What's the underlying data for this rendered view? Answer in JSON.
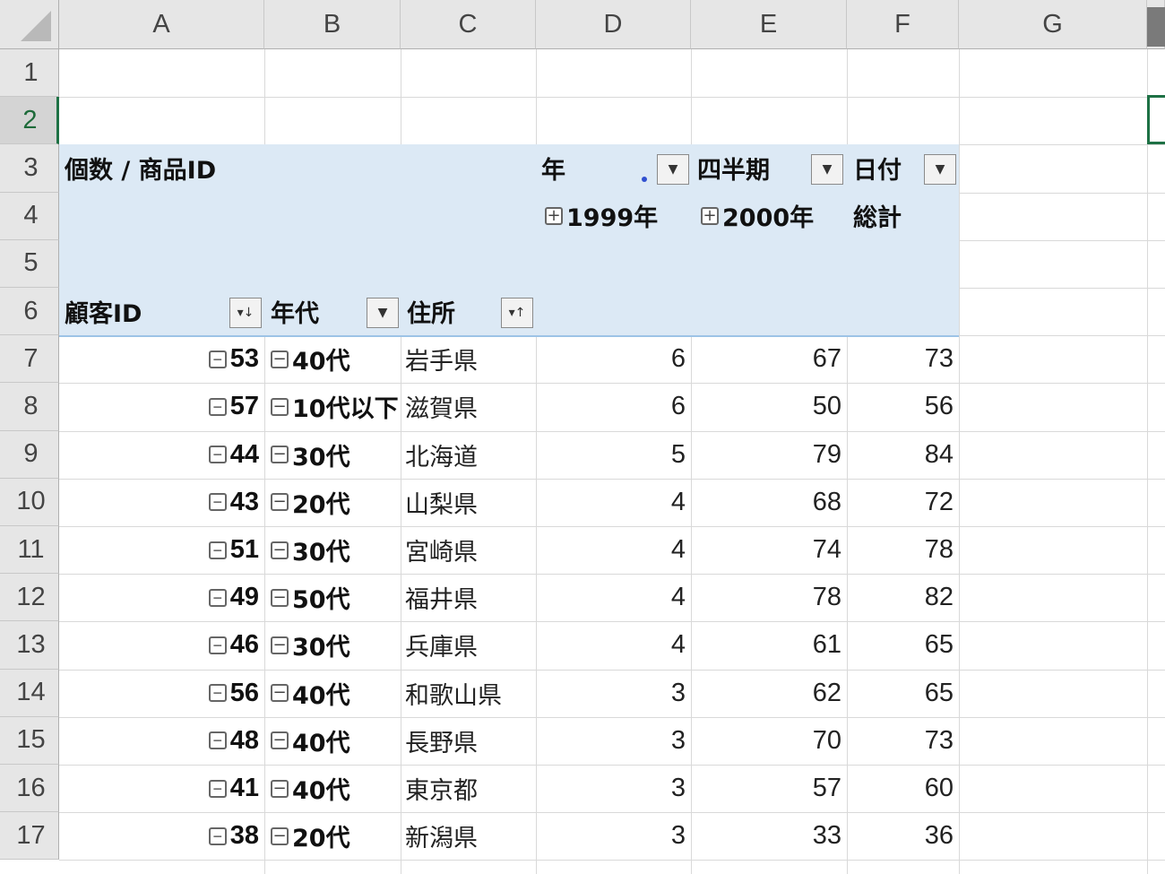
{
  "columns": [
    "A",
    "B",
    "C",
    "D",
    "E",
    "F",
    "G"
  ],
  "rows": [
    "1",
    "2",
    "3",
    "4",
    "5",
    "6",
    "7",
    "8",
    "9",
    "10",
    "11",
    "12",
    "13",
    "14",
    "15",
    "16",
    "17"
  ],
  "selected_row": "2",
  "pivot": {
    "value_field": "個数 / 商品ID",
    "col_fields": [
      {
        "label": "年",
        "icon": "filter-active-icon"
      },
      {
        "label": "四半期",
        "icon": "dropdown-arrow-icon"
      },
      {
        "label": "日付",
        "icon": "dropdown-arrow-icon"
      }
    ],
    "col_items": [
      "1999年",
      "2000年"
    ],
    "grand_total": "総計",
    "row_fields": [
      {
        "label": "顧客ID",
        "icon": "sort-descending-icon"
      },
      {
        "label": "年代",
        "icon": "dropdown-arrow-icon"
      },
      {
        "label": "住所",
        "icon": "sort-ascending-icon"
      }
    ],
    "rows": [
      {
        "customer_id": "53",
        "age": "40代",
        "address": "岩手県",
        "y1999": "6",
        "y2000": "67",
        "total": "73"
      },
      {
        "customer_id": "57",
        "age": "10代以下",
        "address": "滋賀県",
        "y1999": "6",
        "y2000": "50",
        "total": "56"
      },
      {
        "customer_id": "44",
        "age": "30代",
        "address": "北海道",
        "y1999": "5",
        "y2000": "79",
        "total": "84"
      },
      {
        "customer_id": "43",
        "age": "20代",
        "address": "山梨県",
        "y1999": "4",
        "y2000": "68",
        "total": "72"
      },
      {
        "customer_id": "51",
        "age": "30代",
        "address": "宮崎県",
        "y1999": "4",
        "y2000": "74",
        "total": "78"
      },
      {
        "customer_id": "49",
        "age": "50代",
        "address": "福井県",
        "y1999": "4",
        "y2000": "78",
        "total": "82"
      },
      {
        "customer_id": "46",
        "age": "30代",
        "address": "兵庫県",
        "y1999": "4",
        "y2000": "61",
        "total": "65"
      },
      {
        "customer_id": "56",
        "age": "40代",
        "address": "和歌山県",
        "y1999": "3",
        "y2000": "62",
        "total": "65"
      },
      {
        "customer_id": "48",
        "age": "40代",
        "address": "長野県",
        "y1999": "3",
        "y2000": "70",
        "total": "73"
      },
      {
        "customer_id": "41",
        "age": "40代",
        "address": "東京都",
        "y1999": "3",
        "y2000": "57",
        "total": "60"
      },
      {
        "customer_id": "38",
        "age": "20代",
        "address": "新潟県",
        "y1999": "3",
        "y2000": "33",
        "total": "36"
      }
    ]
  },
  "colors": {
    "pivot_header_bg": "#dce9f5",
    "selection_border": "#1e7145",
    "header_bg": "#e6e6e6"
  }
}
